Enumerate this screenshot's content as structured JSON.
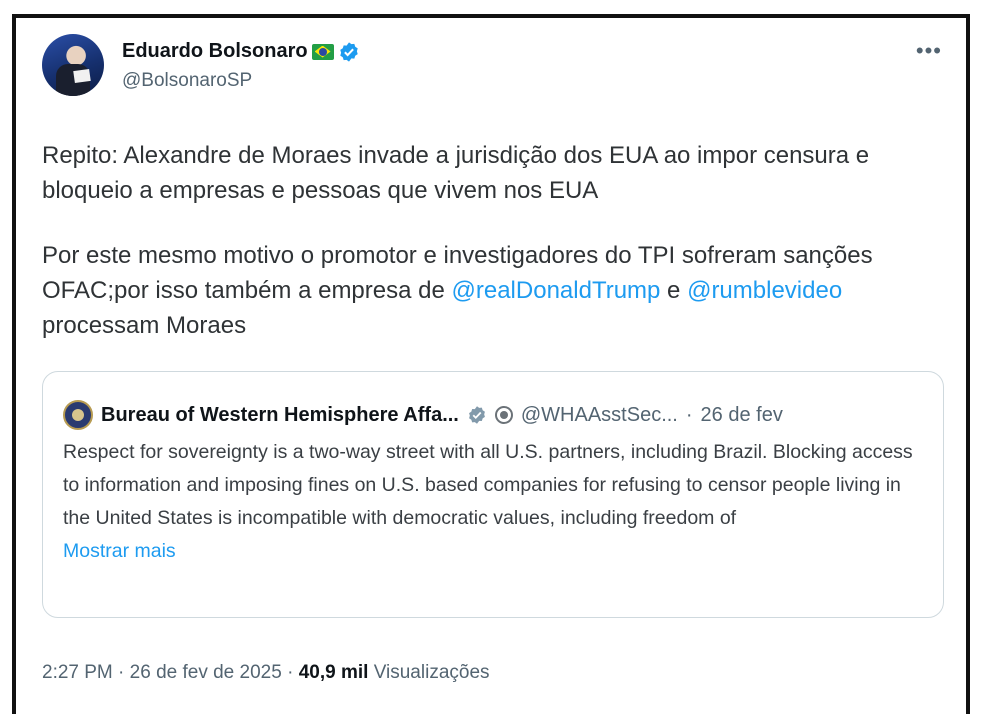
{
  "author": {
    "name": "Eduardo Bolsonaro",
    "handle": "@BolsonaroSP"
  },
  "tweet": {
    "paragraph1": "Repito: Alexandre de Moraes invade a jurisdição dos EUA ao impor censura e bloqueio a empresas e pessoas que vivem nos EUA",
    "paragraph2_part1": "Por este mesmo motivo o promotor e investigadores do TPI sofreram sanções OFAC;por isso também a empresa de ",
    "mention1": "@realDonaldTrump",
    "paragraph2_part2": " e ",
    "mention2": "@rumblevideo",
    "paragraph2_part3": " processam Moraes"
  },
  "quote": {
    "name": "Bureau of Western Hemisphere Affa...",
    "handle": "@WHAAsstSec...",
    "separator": "·",
    "date": "26 de fev",
    "text": "Respect for sovereignty is a two-way street with all U.S. partners, including Brazil. Blocking access to information and imposing fines on U.S. based companies for refusing to censor people living in the United States is incompatible with democratic values, including freedom of",
    "show_more": "Mostrar mais"
  },
  "footer": {
    "time": "2:27 PM",
    "date": "26 de fev de 2025",
    "views_count": "40,9 mil",
    "views_label": "Visualizações",
    "sep": "·"
  },
  "colors": {
    "link": "#1d9bf0",
    "muted": "#536471",
    "verified": "#1d9bf0",
    "gray_verified": "#829aab"
  },
  "icons": {
    "more": "more-icon",
    "flag": "brazil-flag-icon",
    "verified": "verified-icon"
  }
}
